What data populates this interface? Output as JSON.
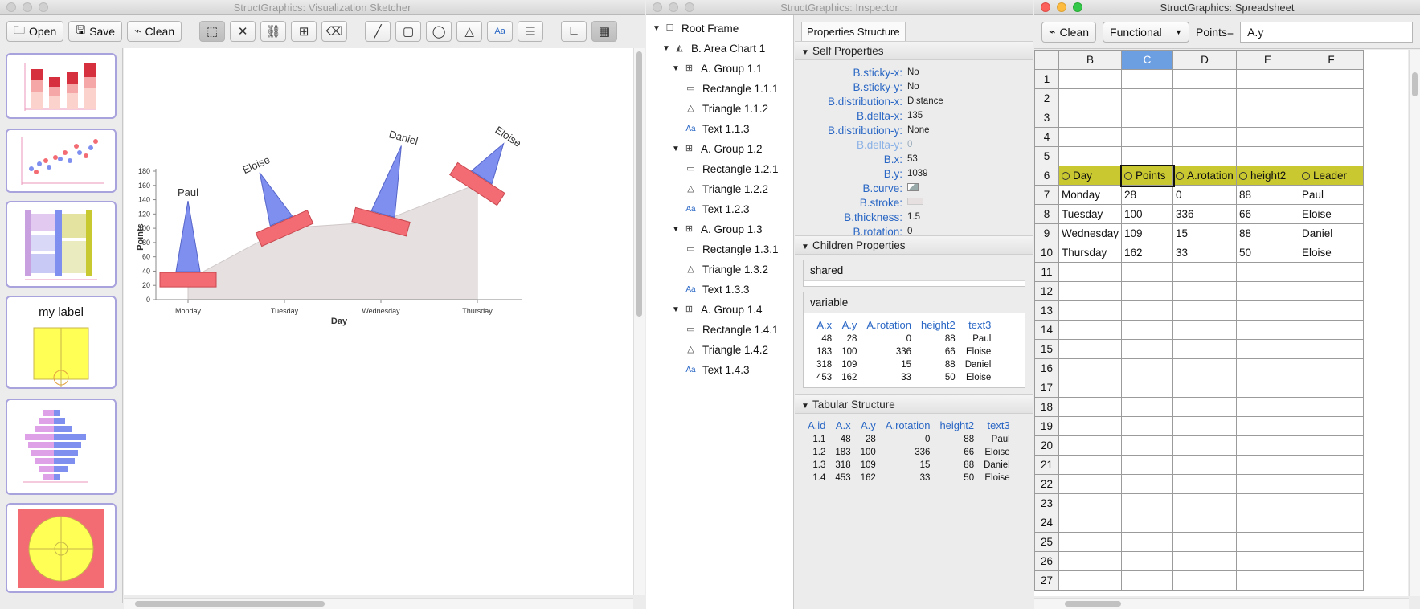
{
  "sketcher": {
    "title": "StructGraphics: Visualization Sketcher",
    "buttons": {
      "open": "Open",
      "save": "Save",
      "clean": "Clean"
    },
    "thumb_label": "my label",
    "chart": {
      "xlabel": "Day",
      "ylabel": "Points",
      "yticks": [
        "0",
        "20",
        "40",
        "60",
        "80",
        "100",
        "120",
        "140",
        "160",
        "180"
      ],
      "categories": [
        "Monday",
        "Tuesday",
        "Wednesday",
        "Thursday"
      ],
      "leaders": [
        "Paul",
        "Eloise",
        "Daniel",
        "Eloise"
      ]
    }
  },
  "inspector": {
    "title": "StructGraphics: Inspector",
    "tree": [
      {
        "label": "Root Frame",
        "icon": "frame-icon",
        "level": 0,
        "exp": true
      },
      {
        "label": "B. Area Chart 1",
        "icon": "area-chart-icon",
        "level": 1,
        "exp": true
      },
      {
        "label": "A. Group 1.1",
        "icon": "group-icon",
        "level": 2,
        "exp": true
      },
      {
        "label": "Rectangle 1.1.1",
        "icon": "rectangle-icon",
        "level": 3,
        "exp": false
      },
      {
        "label": "Triangle 1.1.2",
        "icon": "triangle-icon",
        "level": 3,
        "exp": false
      },
      {
        "label": "Text 1.1.3",
        "icon": "text-icon",
        "level": 3,
        "exp": false
      },
      {
        "label": "A. Group 1.2",
        "icon": "group-icon",
        "level": 2,
        "exp": true
      },
      {
        "label": "Rectangle 1.2.1",
        "icon": "rectangle-icon",
        "level": 3,
        "exp": false
      },
      {
        "label": "Triangle 1.2.2",
        "icon": "triangle-icon",
        "level": 3,
        "exp": false
      },
      {
        "label": "Text 1.2.3",
        "icon": "text-icon",
        "level": 3,
        "exp": false
      },
      {
        "label": "A. Group 1.3",
        "icon": "group-icon",
        "level": 2,
        "exp": true
      },
      {
        "label": "Rectangle 1.3.1",
        "icon": "rectangle-icon",
        "level": 3,
        "exp": false
      },
      {
        "label": "Triangle 1.3.2",
        "icon": "triangle-icon",
        "level": 3,
        "exp": false
      },
      {
        "label": "Text 1.3.3",
        "icon": "text-icon",
        "level": 3,
        "exp": false
      },
      {
        "label": "A. Group 1.4",
        "icon": "group-icon",
        "level": 2,
        "exp": true
      },
      {
        "label": "Rectangle 1.4.1",
        "icon": "rectangle-icon",
        "level": 3,
        "exp": false
      },
      {
        "label": "Triangle 1.4.2",
        "icon": "triangle-icon",
        "level": 3,
        "exp": false
      },
      {
        "label": "Text 1.4.3",
        "icon": "text-icon",
        "level": 3,
        "exp": false
      }
    ],
    "tab": "Properties Structure",
    "self_header": "Self Properties",
    "self_props": [
      {
        "k": "B.sticky-x:",
        "v": "No",
        "dim": false
      },
      {
        "k": "B.sticky-y:",
        "v": "No",
        "dim": false
      },
      {
        "k": "B.distribution-x:",
        "v": "Distance",
        "dim": false
      },
      {
        "k": "B.delta-x:",
        "v": "135",
        "dim": false
      },
      {
        "k": "B.distribution-y:",
        "v": "None",
        "dim": false
      },
      {
        "k": "B.delta-y:",
        "v": "0",
        "dim": true
      },
      {
        "k": "B.x:",
        "v": "53",
        "dim": false
      },
      {
        "k": "B.y:",
        "v": "1039",
        "dim": false
      },
      {
        "k": "B.curve:",
        "v": "",
        "dim": false
      },
      {
        "k": "B.stroke:",
        "v": "",
        "dim": false
      },
      {
        "k": "B.thickness:",
        "v": "1.5",
        "dim": false
      },
      {
        "k": "B.rotation:",
        "v": "0",
        "dim": false
      }
    ],
    "children_header": "Children Properties",
    "shared_label": "shared",
    "variable_label": "variable",
    "variable_cols": [
      "A.x",
      "A.y",
      "A.rotation",
      "height2",
      "text3"
    ],
    "variable_rows": [
      [
        "48",
        "28",
        "0",
        "88",
        "Paul"
      ],
      [
        "183",
        "100",
        "336",
        "66",
        "Eloise"
      ],
      [
        "318",
        "109",
        "15",
        "88",
        "Daniel"
      ],
      [
        "453",
        "162",
        "33",
        "50",
        "Eloise"
      ]
    ],
    "tabular_header": "Tabular Structure",
    "tabular_cols": [
      "A.id",
      "A.x",
      "A.y",
      "A.rotation",
      "height2",
      "text3"
    ],
    "tabular_rows": [
      [
        "1.1",
        "48",
        "28",
        "0",
        "88",
        "Paul"
      ],
      [
        "1.2",
        "183",
        "100",
        "336",
        "66",
        "Eloise"
      ],
      [
        "1.3",
        "318",
        "109",
        "15",
        "88",
        "Daniel"
      ],
      [
        "1.4",
        "453",
        "162",
        "33",
        "50",
        "Eloise"
      ]
    ]
  },
  "spreadsheet": {
    "title": "StructGraphics: Spreadsheet",
    "clean": "Clean",
    "mode": "Functional",
    "formula_label": "Points=",
    "formula_value": "A.y",
    "columns": [
      "B",
      "C",
      "D",
      "E",
      "F"
    ],
    "headers": [
      "Day",
      "Points",
      "A.rotation",
      "height2",
      "Leader"
    ],
    "rows": [
      [
        "Monday",
        "28",
        "0",
        "88",
        "Paul"
      ],
      [
        "Tuesday",
        "100",
        "336",
        "66",
        "Eloise"
      ],
      [
        "Wednesday",
        "109",
        "15",
        "88",
        "Daniel"
      ],
      [
        "Thursday",
        "162",
        "33",
        "50",
        "Eloise"
      ]
    ],
    "row_numbers": [
      "1",
      "2",
      "3",
      "4",
      "5",
      "6",
      "7",
      "8",
      "9",
      "10",
      "11",
      "12",
      "13",
      "14",
      "15",
      "16",
      "17",
      "18",
      "19",
      "20",
      "21",
      "22",
      "23",
      "24",
      "25",
      "26",
      "27"
    ]
  },
  "colors": {
    "rect": "#f46c73",
    "tri": "#7f8ff0",
    "area": "#e6e0e0",
    "header_fill": "#c9c830",
    "link": "#2a67c5",
    "thumb_border": "#a9a3dd"
  }
}
